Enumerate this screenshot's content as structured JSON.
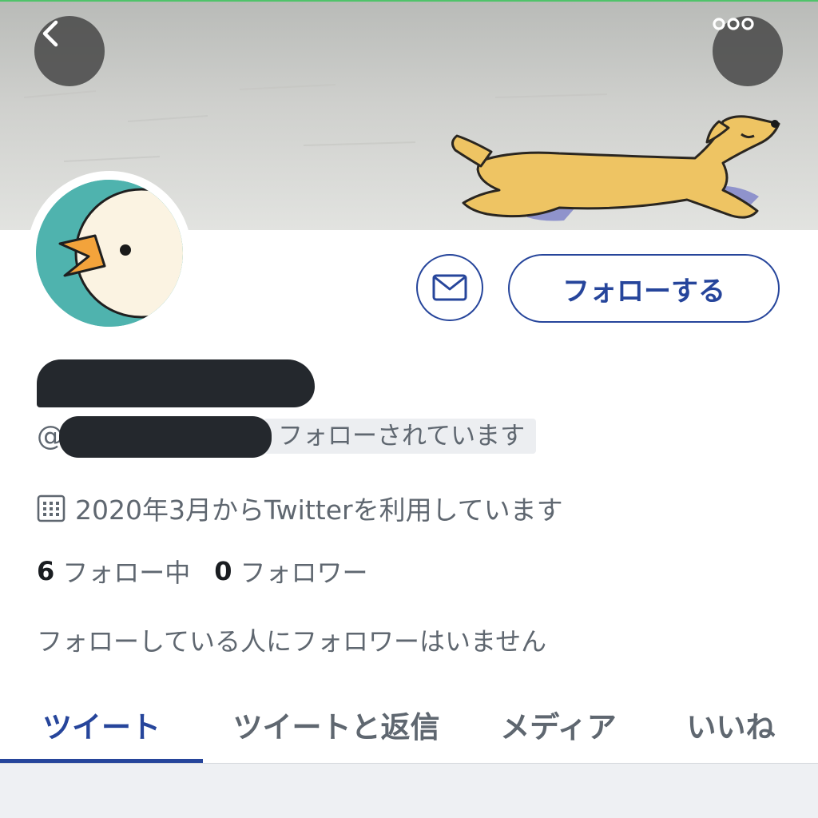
{
  "colors": {
    "accent": "#26459b",
    "secondary_text": "#5f6770",
    "avatar_background": "#4fb3ae"
  },
  "header": {
    "back_icon": "chevron-left-icon",
    "more_icon": "more-horizontal-icon"
  },
  "profile": {
    "handle_prefix": "@",
    "follows_you_label": "フォローされています",
    "joined_icon": "calendar-icon",
    "joined_text": "2020年3月からTwitterを利用しています",
    "following_count": "6",
    "following_label": "フォロー中",
    "followers_count": "0",
    "followers_label": "フォロワー",
    "followers_you_know": "フォローしている人にフォロワーはいません"
  },
  "actions": {
    "message_icon": "mail-icon",
    "follow_label": "フォローする"
  },
  "tabs": [
    {
      "label": "ツイート",
      "active": true
    },
    {
      "label": "ツイートと返信",
      "active": false
    },
    {
      "label": "メディア",
      "active": false
    },
    {
      "label": "いいね",
      "active": false
    }
  ]
}
